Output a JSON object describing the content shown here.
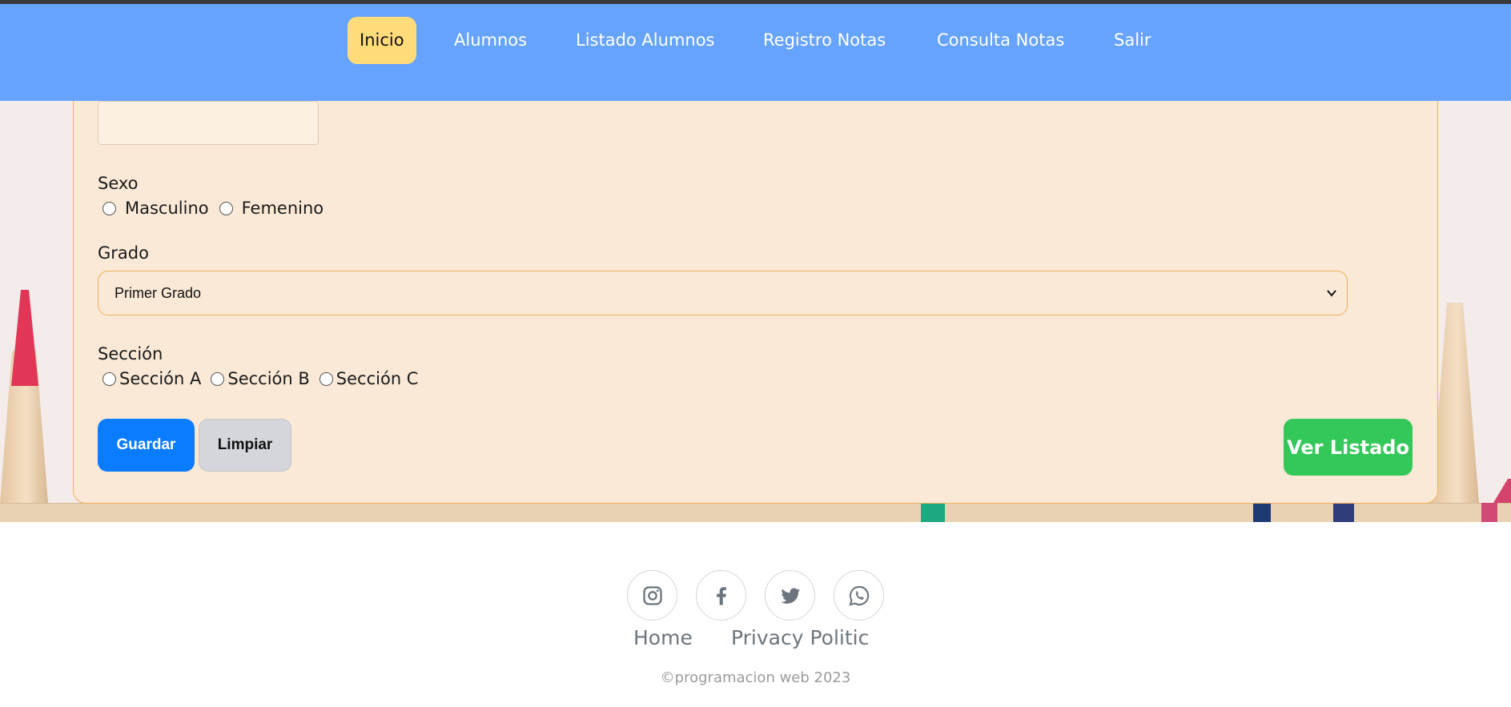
{
  "nav": {
    "items": [
      {
        "label": "Inicio",
        "active": true
      },
      {
        "label": "Alumnos"
      },
      {
        "label": "Listado Alumnos"
      },
      {
        "label": "Registro Notas"
      },
      {
        "label": "Consulta Notas"
      },
      {
        "label": "Salir"
      }
    ]
  },
  "form": {
    "name_value": "",
    "sexo_label": "Sexo",
    "sexo_options": [
      "Masculino",
      "Femenino"
    ],
    "grado_label": "Grado",
    "grado_selected": "Primer Grado",
    "seccion_label": "Sección",
    "seccion_options": [
      "Sección A",
      "Sección B",
      "Sección C"
    ],
    "guardar_label": "Guardar",
    "limpiar_label": "Limpiar",
    "listado_label": "Ver Listado"
  },
  "footer": {
    "social_icons": [
      "instagram-icon",
      "facebook-icon",
      "twitter-icon",
      "whatsapp-icon"
    ],
    "links": [
      "Home",
      "Privacy Politic"
    ],
    "copyright": "©programacion web 2023"
  },
  "colors": {
    "navbar": "#66a3ff",
    "active_nav": "#ffdb7a",
    "card": "#fae9d6",
    "card_border": "#efb15d",
    "guardar": "#0a7cff",
    "limpiar": "#d4d6db",
    "listado": "#34c759"
  }
}
